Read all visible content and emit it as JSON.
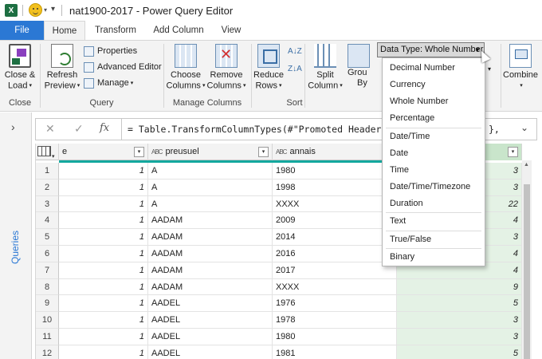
{
  "window": {
    "title": "nat1900-2017 - Power Query Editor",
    "excel_icon": "X",
    "qa_caret": "▾",
    "smiley_caret": "▾"
  },
  "tabs": [
    {
      "label": "File"
    },
    {
      "label": "Home"
    },
    {
      "label": "Transform"
    },
    {
      "label": "Add Column"
    },
    {
      "label": "View"
    }
  ],
  "ribbon": {
    "close": {
      "line1": "Close &",
      "line2": "Load",
      "group": "Close"
    },
    "refresh": {
      "line1": "Refresh",
      "line2": "Preview",
      "group": "Query"
    },
    "properties": "Properties",
    "advanced_editor": "Advanced Editor",
    "manage": "Manage",
    "choose": {
      "line1": "Choose",
      "line2": "Columns"
    },
    "remove": {
      "line1": "Remove",
      "line2": "Columns"
    },
    "manage_columns_group": "Manage Columns",
    "reduce": {
      "line1": "Reduce",
      "line2": "Rows"
    },
    "sort_group": "Sort",
    "sort_az": "A↓Z",
    "sort_za": "Z↓A",
    "split": {
      "line1": "Split",
      "line2": "Column"
    },
    "group": {
      "line1": "Grou",
      "line2": "By"
    },
    "combine": {
      "line1": "Combine"
    },
    "caret": "▾"
  },
  "data_type_button": {
    "label": "Data Type: Whole Number",
    "caret": "▼"
  },
  "data_type_menu": [
    "Decimal Number",
    "Currency",
    "Whole Number",
    "Percentage",
    "Date/Time",
    "Date",
    "Time",
    "Date/Time/Timezone",
    "Duration",
    "Text",
    "True/False",
    "Binary"
  ],
  "formula_bar": {
    "cancel": "✕",
    "ok": "✓",
    "fx": "fx",
    "text": "= Table.TransformColumnTypes(#\"Promoted Header",
    "text_tail": "},",
    "expand": "⌄"
  },
  "left_panel": {
    "chevron": "›",
    "queries_label": "Queries"
  },
  "grid": {
    "columns": [
      {
        "label": "e",
        "type": ""
      },
      {
        "label": "preusuel",
        "type": "ABC"
      },
      {
        "label": "annais",
        "type": "ABC"
      },
      {
        "label": "",
        "type": ""
      }
    ],
    "rows": [
      {
        "n": "1",
        "a": "1",
        "b": "A",
        "c": "1980",
        "d": "3"
      },
      {
        "n": "2",
        "a": "1",
        "b": "A",
        "c": "1998",
        "d": "3"
      },
      {
        "n": "3",
        "a": "1",
        "b": "A",
        "c": "XXXX",
        "d": "22"
      },
      {
        "n": "4",
        "a": "1",
        "b": "AADAM",
        "c": "2009",
        "d": "4"
      },
      {
        "n": "5",
        "a": "1",
        "b": "AADAM",
        "c": "2014",
        "d": "3"
      },
      {
        "n": "6",
        "a": "1",
        "b": "AADAM",
        "c": "2016",
        "d": "4"
      },
      {
        "n": "7",
        "a": "1",
        "b": "AADAM",
        "c": "2017",
        "d": "4"
      },
      {
        "n": "8",
        "a": "1",
        "b": "AADAM",
        "c": "XXXX",
        "d": "9"
      },
      {
        "n": "9",
        "a": "1",
        "b": "AADEL",
        "c": "1976",
        "d": "5"
      },
      {
        "n": "10",
        "a": "1",
        "b": "AADEL",
        "c": "1978",
        "d": "3"
      },
      {
        "n": "11",
        "a": "1",
        "b": "AADEL",
        "c": "1980",
        "d": "3"
      },
      {
        "n": "12",
        "a": "1",
        "b": "AADEL",
        "c": "1981",
        "d": "5"
      }
    ],
    "filter_glyph": "▾"
  }
}
